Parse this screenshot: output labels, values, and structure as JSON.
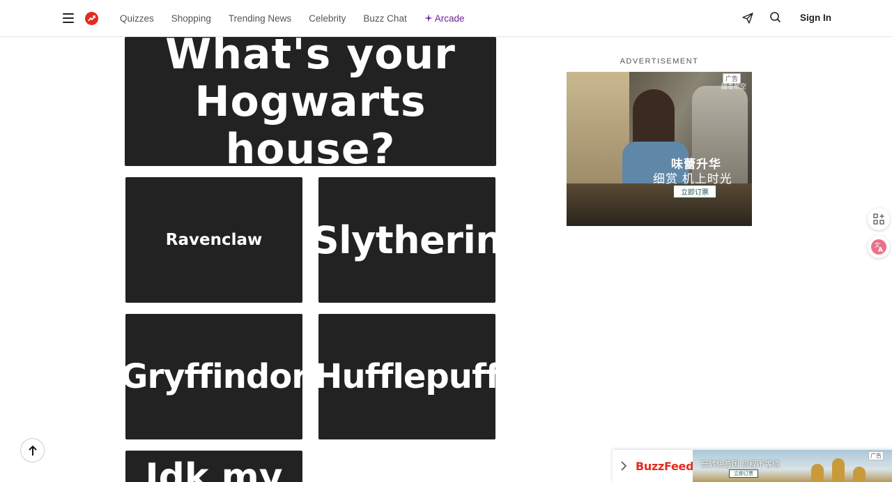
{
  "header": {
    "nav": [
      {
        "label": "Quizzes"
      },
      {
        "label": "Shopping"
      },
      {
        "label": "Trending News"
      },
      {
        "label": "Celebrity"
      },
      {
        "label": "Buzz Chat"
      },
      {
        "label": "Arcade"
      }
    ],
    "sign_in_label": "Sign In"
  },
  "quiz": {
    "title": "What's your Hogwarts house?",
    "options": [
      {
        "label": "Ravenclaw"
      },
      {
        "label": "Slytherin"
      },
      {
        "label": "Gryffindor"
      },
      {
        "label": "Hufflepuff"
      },
      {
        "label": "Idk my"
      }
    ]
  },
  "advertisement": {
    "label": "ADVERTISEMENT",
    "badge": "广告",
    "brand": "國泰航空",
    "headline": "味蕾升华",
    "subline": "细赏 机上时光",
    "cta": "立即订票"
  },
  "sticky_ad": {
    "brand": "BuzzFeed",
    "banner_text": "玩转免签国 启程不等待",
    "cta": "立即订票",
    "badge": "广告"
  },
  "colors": {
    "brand_red": "#e32c1e",
    "tile_bg": "#222222",
    "arcade_purple": "#6d2391"
  }
}
